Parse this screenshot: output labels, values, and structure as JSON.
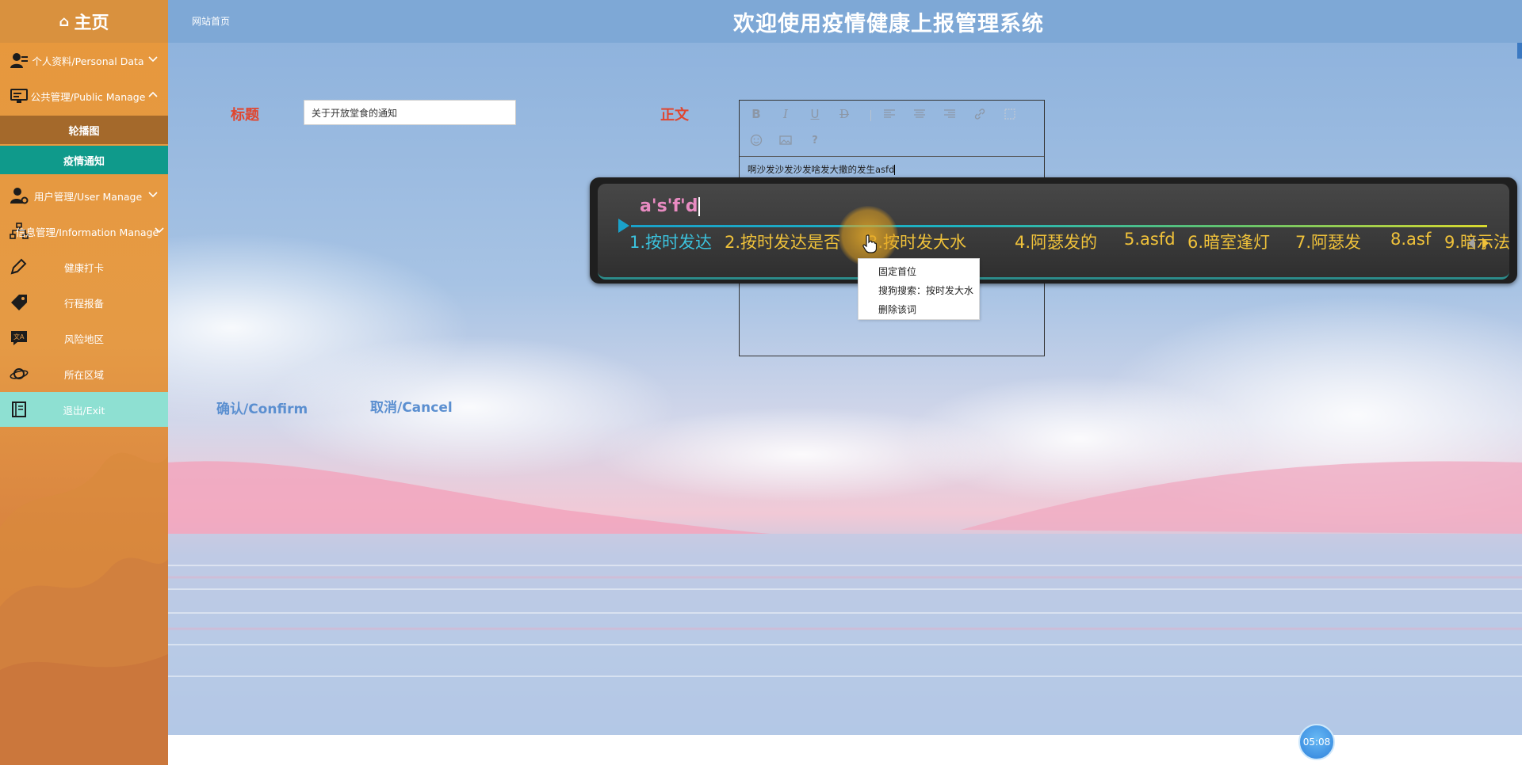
{
  "sidebar": {
    "home": "主页",
    "items": [
      {
        "label": "个人资料/Personal Data"
      },
      {
        "label": "公共管理/Public Manage"
      },
      {
        "label": "用户管理/User Manage"
      },
      {
        "label": "信息管理/Information Manage"
      },
      {
        "label": "健康打卡"
      },
      {
        "label": "行程报备"
      },
      {
        "label": "风险地区"
      },
      {
        "label": "所在区域"
      },
      {
        "label": "退出/Exit"
      }
    ],
    "sub_items": [
      "轮播图",
      "疫情通知"
    ]
  },
  "header": {
    "breadcrumb": "网站首页",
    "title": "欢迎使用疫情健康上报管理系统"
  },
  "form": {
    "title_label": "标题",
    "title_value": "关于开放堂食的通知",
    "body_label": "正文",
    "body_content": "啊沙发沙发沙发啥发大撒的发生asfd",
    "confirm": "确认/Confirm",
    "cancel": "取消/Cancel"
  },
  "editor_toolbar": {
    "bold": "B",
    "italic": "I",
    "underline": "U",
    "strike": "D",
    "help": "?"
  },
  "ime": {
    "composition": "a's'f'd",
    "candidates": [
      "1.按时发达",
      "2.按时发达是否",
      "3.按时发大水",
      "4.阿瑟发的",
      "5.asfd",
      "6.暗室逢灯",
      "7.阿瑟发",
      "8.asf",
      "9.暗示法"
    ]
  },
  "context_menu": {
    "items": [
      "固定首位",
      "搜狗搜索：按时发大水",
      "删除该词"
    ]
  },
  "clock": "05:08",
  "colors": {
    "sidebar": "#e59a45",
    "active_sub": "#0f9a8b",
    "topbar": "#7ea8d6",
    "label_red": "#e0462f",
    "button_blue": "#5b8fd0"
  }
}
